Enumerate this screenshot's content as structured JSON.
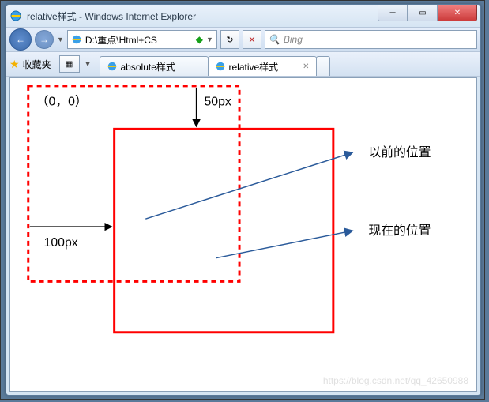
{
  "window": {
    "title": "relative样式 - Windows Internet Explorer"
  },
  "nav": {
    "address": "D:\\重点\\Html+CS",
    "refresh_glyph": "↻",
    "stop_glyph": "✕",
    "search_placeholder": "Bing"
  },
  "fav": {
    "label": "收藏夹"
  },
  "tabs": [
    {
      "label": "absolute样式",
      "active": false
    },
    {
      "label": "relative样式",
      "active": true
    }
  ],
  "diagram": {
    "origin_label": "（0，0）",
    "top_offset_label": "50px",
    "left_offset_label": "100px",
    "label_previous": "以前的位置",
    "label_current": "现在的位置"
  },
  "watermark": "https://blog.csdn.net/qq_42650988"
}
